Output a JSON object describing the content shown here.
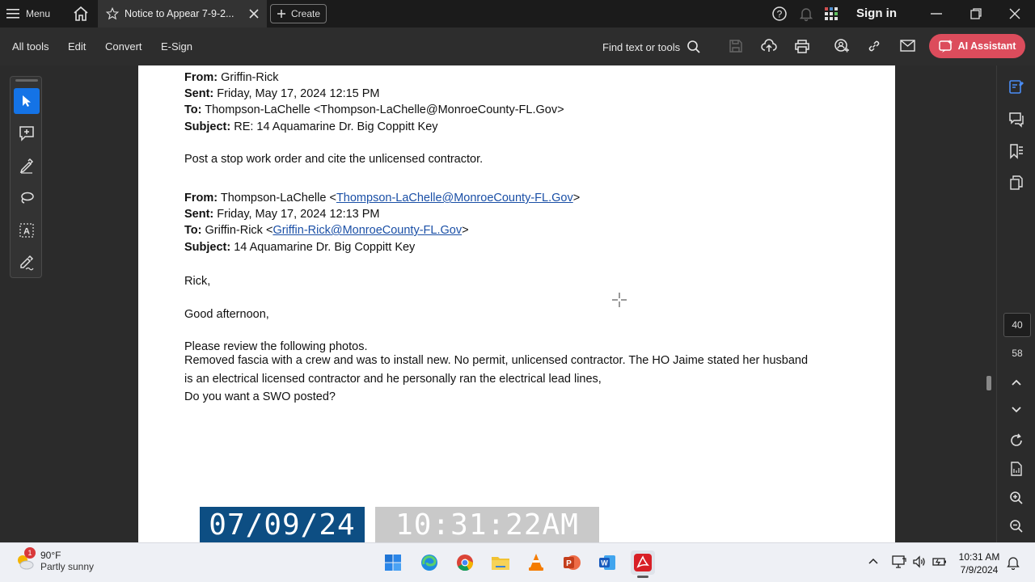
{
  "titlebar": {
    "menu_label": "Menu",
    "tab_title": "Notice to Appear 7-9-2...",
    "create_label": "Create",
    "sign_in_label": "Sign in"
  },
  "toolbar": {
    "all_tools": "All tools",
    "edit": "Edit",
    "convert": "Convert",
    "esign": "E-Sign",
    "find_text": "Find text or tools",
    "ai_assistant": "AI Assistant",
    "ai_color": "#dc4c5c"
  },
  "document": {
    "email1": {
      "from_label": "From:",
      "from_value": " Griffin-Rick",
      "sent_label": "Sent:",
      "sent_value": " Friday, May 17, 2024 12:15 PM",
      "to_label": "To:",
      "to_value": " Thompson-LaChelle <Thompson-LaChelle@MonroeCounty-FL.Gov>",
      "subject_label": "Subject:",
      "subject_value": " RE: 14 Aquamarine Dr. Big Coppitt Key",
      "body": "Post a stop work order and cite the unlicensed contractor."
    },
    "email2": {
      "from_label": "From:",
      "from_name": " Thompson-LaChelle <",
      "from_link": "Thompson-LaChelle@MonroeCounty-FL.Gov",
      "from_close": ">",
      "sent_label": "Sent:",
      "sent_value": " Friday, May 17, 2024 12:13 PM",
      "to_label": "To:",
      "to_name": " Griffin-Rick <",
      "to_link": "Griffin-Rick@MonroeCounty-FL.Gov",
      "to_close": ">",
      "subject_label": "Subject:",
      "subject_value": " 14 Aquamarine Dr. Big Coppitt Key",
      "greeting": "Rick,",
      "salutation": "Good afternoon,",
      "body_1": "Please review the following photos.",
      "body_2": "Removed fascia with a crew and was to install new. No permit, unlicensed contractor. The HO Jaime stated her husband",
      "body_3": "is an electrical licensed contractor and he personally ran the electrical lead lines,",
      "body_4": "Do you want a SWO posted?"
    },
    "link_color": "#1a4fa6"
  },
  "timestamp": {
    "date": "07/09/24",
    "time": "10:31:22AM"
  },
  "right_rail": {
    "current_page": "40",
    "total_pages": "58"
  },
  "taskbar": {
    "weather_badge": "1",
    "temperature": "90°F",
    "condition": "Partly sunny",
    "clock_time": "10:31 AM",
    "clock_date": "7/9/2024",
    "apps": [
      "start-icon",
      "edge-icon",
      "chrome-icon",
      "file-explorer-icon",
      "vlc-icon",
      "powerpoint-icon",
      "word-icon",
      "acrobat-icon"
    ]
  }
}
